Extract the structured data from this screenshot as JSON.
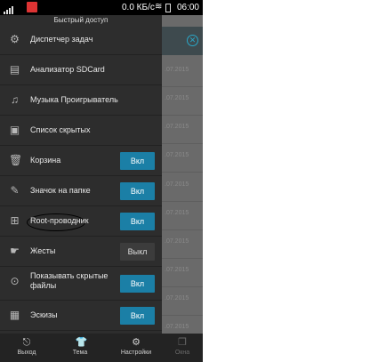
{
  "status_bar": {
    "speed": "0.0 КБ/с",
    "clock": "06:00"
  },
  "drawer": {
    "title": "Быстрый доступ",
    "items": [
      {
        "label": "Диспетчер задач",
        "icon": "settings-icon"
      },
      {
        "label": "Анализатор SDCard",
        "icon": "sdcard-icon"
      },
      {
        "label": "Музыка Проигрыватель",
        "icon": "headphones-icon"
      },
      {
        "label": "Список скрытых",
        "icon": "folder-lock-icon"
      },
      {
        "label": "Корзина",
        "icon": "trash-icon",
        "toggle": "Вкл"
      },
      {
        "label": "Значок на папке",
        "icon": "pin-icon",
        "toggle": "Вкл"
      },
      {
        "label": "Root-проводник",
        "icon": "root-explorer-icon",
        "toggle": "Вкл"
      },
      {
        "label": "Жесты",
        "icon": "gesture-hand-icon",
        "toggle": "Выкл"
      },
      {
        "label": "Показывать скрытые файлы",
        "icon": "hidden-files-icon",
        "toggle": "Вкл"
      },
      {
        "label": "Эскизы",
        "icon": "thumbnails-icon",
        "toggle": "Вкл"
      }
    ]
  },
  "bottom_bar": {
    "exit": "Выход",
    "theme": "Тема",
    "settings": "Настройки",
    "windows": "Окна"
  },
  "background_list": {
    "dates": [
      ".07.2015",
      ".07.2015",
      ".07.2015",
      ".07.2015",
      ".07.2015",
      ".07.2015",
      ".07.2015",
      ".07.2015",
      ".07.2015",
      ".07.2015"
    ]
  },
  "colors": {
    "toggle_on": "#1b7fa6",
    "drawer_bg": "#2d2d2d",
    "accent": "#2aa7c8"
  }
}
